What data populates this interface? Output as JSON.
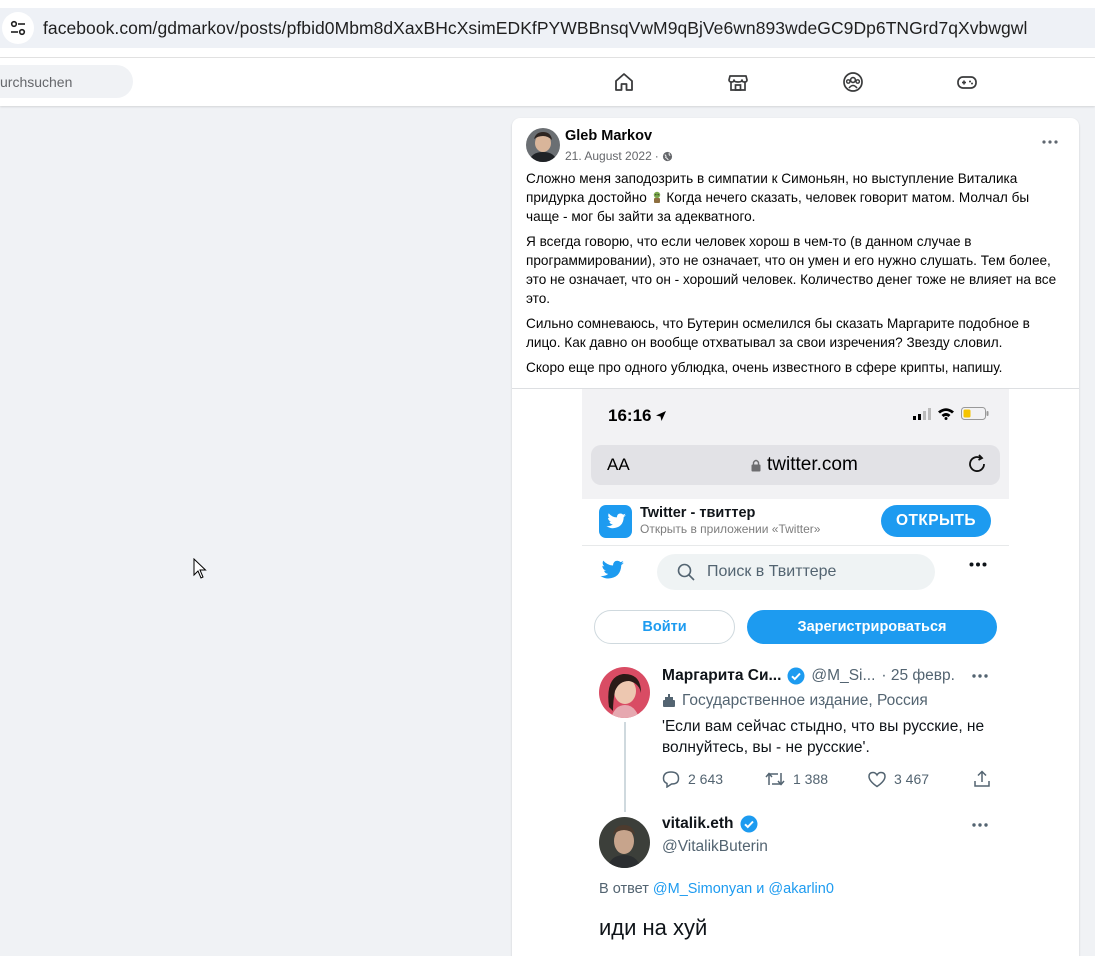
{
  "browser": {
    "url": "facebook.com/gdmarkov/posts/pfbid0Mbm8dXaxBHcXsimEDKfPYWBBnsqVwM9qBjVe6wn893wdeGC9Dp6TNGrd7qXvbwgwl"
  },
  "fb_nav": {
    "search_placeholder": "urchsuchen",
    "icons": [
      "home-icon",
      "marketplace-icon",
      "groups-icon",
      "gaming-icon"
    ]
  },
  "post": {
    "author": "Gleb Markov",
    "date": "21. August 2022",
    "separator": "·",
    "paragraphs": [
      {
        "before": "Сложно меня заподозрить в симпатии к Симоньян, но выступление Виталика придурка достойно",
        "after": " Когда нечего сказать, человек говорит матом. Молчал бы чаще - мог бы зайти за адекватного."
      },
      "Я всегда говорю, что если человек хорош в чем-то (в данном случае в программировании), это не означает, что он умен и его нужно слушать. Тем более, это не означает, что он - хороший человек. Количество денег тоже не влияет на все это.",
      "Сильно сомневаюсь, что Бутерин осмелился бы сказать Маргарите подобное в лицо. Как давно он вообще отхватывал за свои изречения? Звезду словил.",
      "Скоро еще про одного ублюдка, очень известного в сфере крипты, напишу."
    ]
  },
  "screenshot": {
    "time": "16:16",
    "address_aa": "AA",
    "address_url": "twitter.com",
    "banner": {
      "title": "Twitter - твиттер",
      "subtitle": "Открыть в приложении «Twitter»",
      "open_label": "ОТКРЫТЬ"
    },
    "search_placeholder": "Поиск в Твиттере",
    "login_label": "Войти",
    "signup_label": "Зарегистрироваться",
    "tweet1": {
      "name": "Маргарита Си...",
      "handle": "@M_Si...",
      "time": "· 25 февр.",
      "label": "Государственное издание, Россия",
      "text": "'Если вам сейчас стыдно, что вы русские, не волнуйтесь, вы - не русские'.",
      "replies": "2 643",
      "retweets": "1 388",
      "likes": "3 467"
    },
    "tweet2": {
      "name": "vitalik.eth",
      "handle": "@VitalikButerin",
      "reply_prefix": "В ответ",
      "mention1": "@M_Simonyan",
      "reply_and": "и",
      "mention2": "@akarlin0",
      "text": "иди на хуй"
    }
  },
  "colors": {
    "fb_bg": "#f0f2f5",
    "twitter_blue": "#1d9bf0",
    "verified_blue": "#1d9bf0"
  }
}
